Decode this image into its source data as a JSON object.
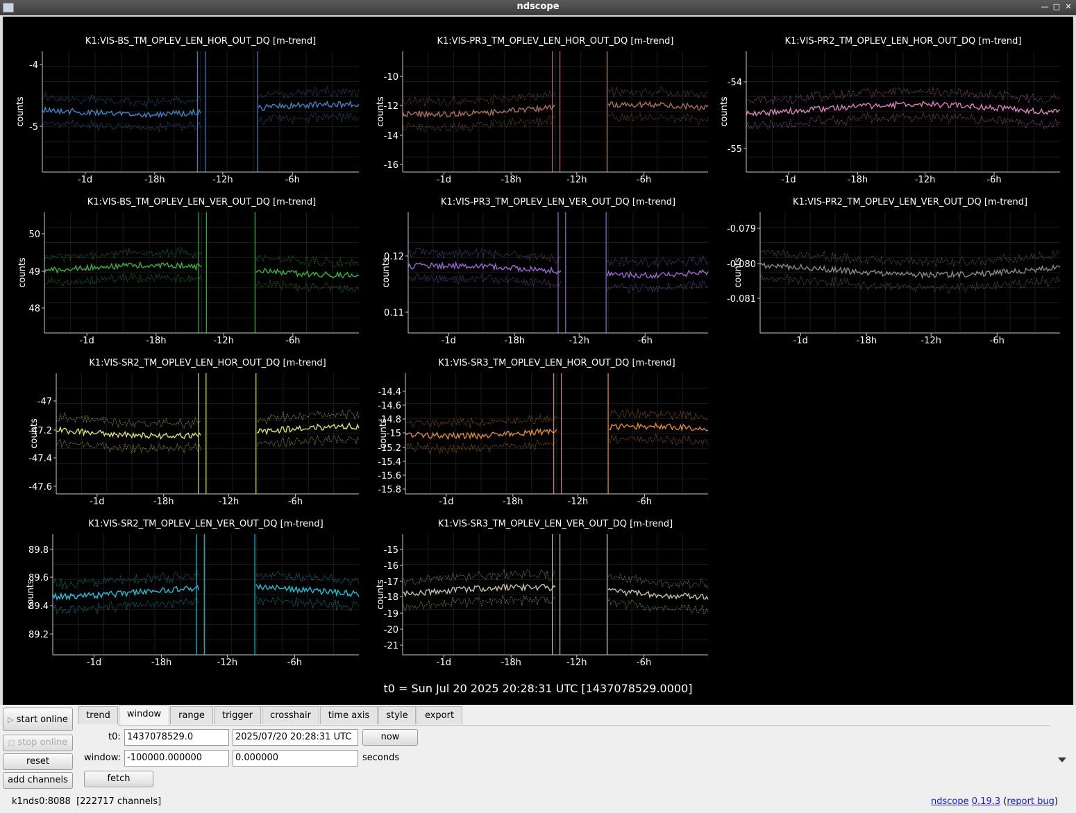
{
  "window": {
    "title": "ndscope"
  },
  "plots": [
    {
      "title": "K1:VIS-BS_TM_OPLEV_LEN_HOR_OUT_DQ [m-trend]",
      "ylabel": "counts",
      "yticks": [
        "-4",
        "-5"
      ],
      "color": "#3a86c8",
      "xticks": [
        "-1d",
        "-18h",
        "-12h",
        "-6h"
      ]
    },
    {
      "title": "K1:VIS-PR3_TM_OPLEV_LEN_HOR_OUT_DQ [m-trend]",
      "ylabel": "counts",
      "yticks": [
        "-10",
        "-12",
        "-14",
        "-16"
      ],
      "color": "#b07060",
      "xticks": [
        "-1d",
        "-18h",
        "-12h",
        "-6h"
      ]
    },
    {
      "title": "K1:VIS-PR2_TM_OPLEV_LEN_HOR_OUT_DQ [m-trend]",
      "ylabel": "counts",
      "yticks": [
        "-54",
        "-55"
      ],
      "color": "#e080c0",
      "xticks": [
        "-1d",
        "-18h",
        "-12h",
        "-6h"
      ]
    },
    {
      "title": "K1:VIS-BS_TM_OPLEV_LEN_VER_OUT_DQ [m-trend]",
      "ylabel": "counts",
      "yticks": [
        "50",
        "49",
        "48"
      ],
      "color": "#3cb040",
      "xticks": [
        "-1d",
        "-18h",
        "-12h",
        "-6h"
      ]
    },
    {
      "title": "K1:VIS-PR3_TM_OPLEV_LEN_VER_OUT_DQ [m-trend]",
      "ylabel": "counts",
      "yticks": [
        "0.12",
        "0.11"
      ],
      "color": "#9a6ad0",
      "xticks": [
        "-1d",
        "-18h",
        "-12h",
        "-6h"
      ]
    },
    {
      "title": "K1:VIS-PR2_TM_OPLEV_LEN_VER_OUT_DQ [m-trend]",
      "ylabel": "counts",
      "yticks": [
        "-0.079",
        "-0.080",
        "-0.081"
      ],
      "color": "#8a8a8a",
      "xticks": [
        "-1d",
        "-18h",
        "-12h",
        "-6h"
      ]
    },
    {
      "title": "K1:VIS-SR2_TM_OPLEV_LEN_HOR_OUT_DQ [m-trend]",
      "ylabel": "counts",
      "yticks": [
        "-47",
        "-47.2",
        "-47.4",
        "-47.6"
      ],
      "color": "#e0e070",
      "xticks": [
        "-1d",
        "-18h",
        "-12h",
        "-6h"
      ]
    },
    {
      "title": "K1:VIS-SR3_TM_OPLEV_LEN_HOR_OUT_DQ [m-trend]",
      "ylabel": "counts",
      "yticks": [
        "-14.4",
        "-14.6",
        "-14.8",
        "-15",
        "-15.2",
        "-15.4",
        "-15.6",
        "-15.8"
      ],
      "color": "#e08a30",
      "xticks": [
        "-1d",
        "-18h",
        "-12h",
        "-6h"
      ]
    },
    {
      "title": "K1:VIS-SR2_TM_OPLEV_LEN_VER_OUT_DQ [m-trend]",
      "ylabel": "counts",
      "yticks": [
        "89.8",
        "89.6",
        "89.4",
        "89.2"
      ],
      "color": "#20c0d8",
      "xticks": [
        "-1d",
        "-18h",
        "-12h",
        "-6h"
      ]
    },
    {
      "title": "K1:VIS-SR3_TM_OPLEV_LEN_VER_OUT_DQ [m-trend]",
      "ylabel": "counts",
      "yticks": [
        "-15",
        "-16",
        "-17",
        "-18",
        "-19",
        "-20",
        "-21"
      ],
      "color": "#c8c0a8",
      "xticks": [
        "-1d",
        "-18h",
        "-12h",
        "-6h"
      ]
    }
  ],
  "t0_label": "t0 = Sun Jul 20 2025 20:28:31 UTC [1437078529.0000]",
  "side_buttons": {
    "start_online": "start online",
    "stop_online": "stop online",
    "reset": "reset",
    "add_channels": "add channels"
  },
  "tabs": [
    "trend",
    "window",
    "range",
    "trigger",
    "crosshair",
    "time axis",
    "style",
    "export"
  ],
  "window_tab": {
    "t0_label": "t0:",
    "t0_gps": "1437078529.0",
    "t0_utc": "2025/07/20 20:28:31 UTC",
    "now_button": "now",
    "window_label": "window:",
    "window_start": "-100000.000000",
    "window_end": "0.000000",
    "seconds_label": "seconds",
    "fetch_button": "fetch"
  },
  "status": {
    "server": "k1nds0:8088",
    "channels": "[222717 channels]",
    "app_link": "ndscope",
    "version_link": "0.19.3",
    "bug_open": "(",
    "bug_link": "report bug",
    "bug_close": ")"
  }
}
